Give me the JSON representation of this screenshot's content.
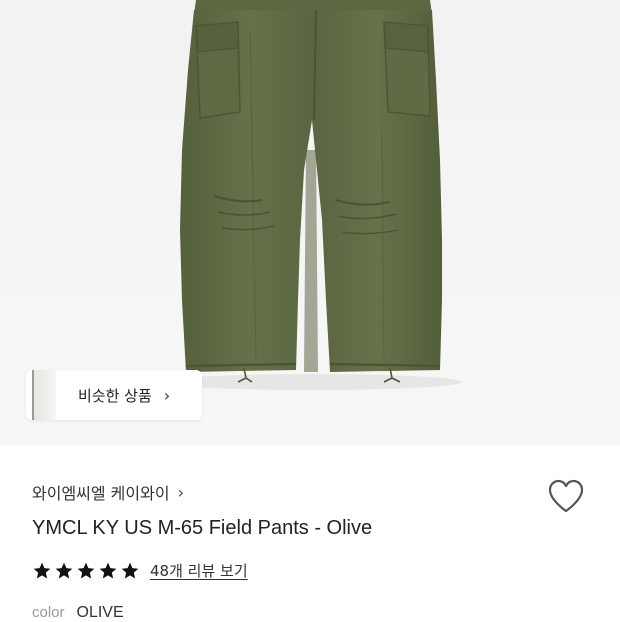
{
  "product_image": {
    "alt": "YMCL KY US M-65 Field Pants - Olive",
    "garment_color": "#5f6b45",
    "background_color": "#f3f3f3"
  },
  "similar_products": {
    "label": "비슷한 상품",
    "chevron": "›"
  },
  "brand": {
    "name": "와이엠씨엘 케이와이",
    "chevron": "›"
  },
  "wishlist": {
    "icon": "heart-outline-icon"
  },
  "product": {
    "title": "YMCL KY US M-65 Field Pants - Olive"
  },
  "rating": {
    "stars": 5,
    "max_stars": 5,
    "review_link": "48개 리뷰 보기"
  },
  "option": {
    "label": "color",
    "value": "OLIVE"
  }
}
